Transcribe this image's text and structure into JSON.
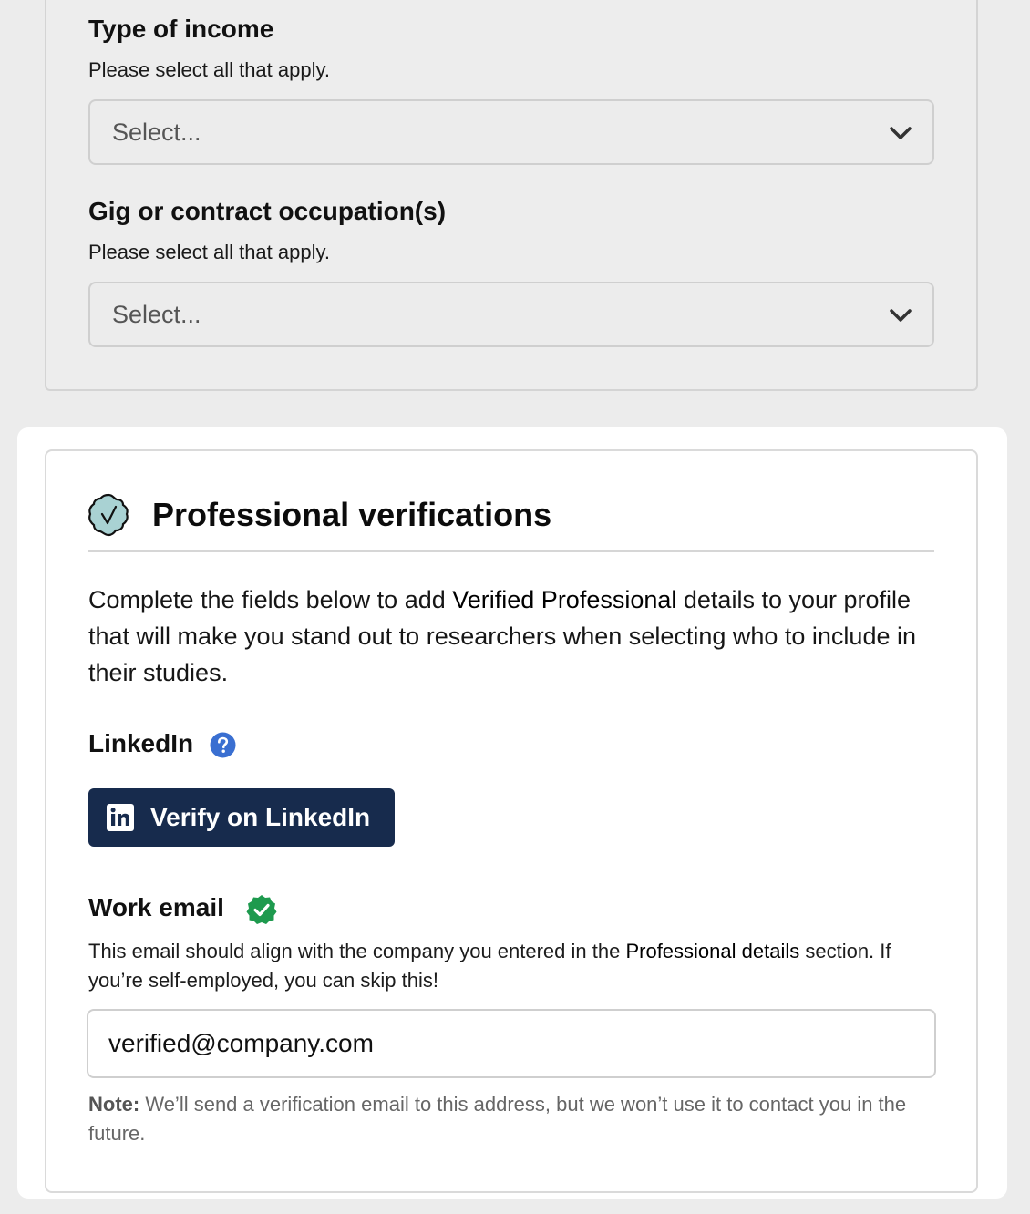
{
  "income_section": {
    "type_of_income": {
      "label": "Type of income",
      "help": "Please select all that apply.",
      "placeholder": "Select..."
    },
    "gig_occupation": {
      "label": "Gig or contract occupation(s)",
      "help": "Please select all that apply.",
      "placeholder": "Select..."
    }
  },
  "verifications": {
    "title": "Professional verifications",
    "intro_pre": "Complete the fields below to add ",
    "intro_bold": "Verified Professional",
    "intro_post": " details to your profile that will make you stand out to researchers when selecting who to include in their studies.",
    "linkedin": {
      "label": "LinkedIn",
      "button_label": "Verify on LinkedIn",
      "button_color": "#172b4d"
    },
    "work_email": {
      "label": "Work email",
      "help_pre": "This email should align with the company you entered in the ",
      "help_bold": "Professional details",
      "help_post": " section. If you’re self-employed, you can skip this!",
      "value": "verified@company.com",
      "note_label": "Note:",
      "note_text": " We’ll send a verification email to this address, but we won’t use it to contact you in the future.",
      "verified_color": "#1e9a4e"
    }
  }
}
